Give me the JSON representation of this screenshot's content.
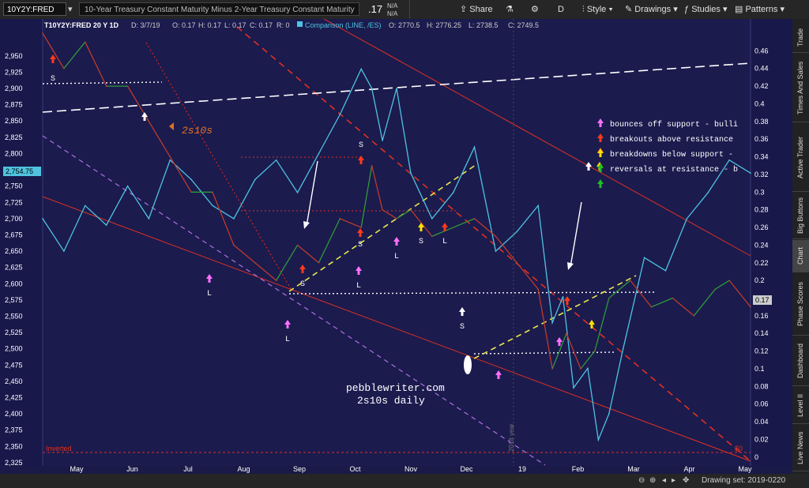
{
  "toolbar": {
    "symbol": "10Y2Y:FRED",
    "description": "10-Year Treasury Constant Maturity Minus 2-Year Treasury Constant Maturity",
    "last": ".17",
    "na1": "N/A",
    "na2": "N/A",
    "share": "Share",
    "flask": "⚗",
    "gear": "⚙",
    "period": "D",
    "style": "Style",
    "drawings": "Drawings",
    "studies": "Studies",
    "patterns": "Patterns"
  },
  "header": {
    "symbol_line": "T10Y2Y:FRED 20 Y 1D",
    "d": "D: 3/7/19",
    "o": "O: 0.17",
    "h": "H: 0.17",
    "l": "L: 0.17",
    "c": "C: 0.17",
    "r": "R: 0",
    "comparison": "Comparison (LINE, /ES)",
    "co": "O: 2770.5",
    "ch": "H: 2776.25",
    "cl": "L: 2738.5",
    "cc": "C: 2749.5"
  },
  "price_tag": "2,754.75",
  "last_tag": "0.17",
  "colors": {
    "background": "#1a1a48",
    "es_line": "#4fc3e0",
    "spread_up": "#2e9a3a",
    "spread_down": "#c0392b",
    "support_dashed": "#e8e84a",
    "channel_red": "#e03020",
    "channel_purple": "#b070e0",
    "white_dashed": "#ffffff",
    "arrow_pink": "#ff70ff",
    "arrow_red": "#ff3a1a",
    "arrow_yellow": "#ffe000",
    "arrow_green": "#20c020",
    "arrow_white": "#ffffff",
    "label_orange": "#e07020"
  },
  "legend": [
    {
      "text": "bounces off support - bulli",
      "color": "#ff70ff"
    },
    {
      "text": "breakouts above resistance",
      "color": "#ff3a1a"
    },
    {
      "text": "breakdowns below support -",
      "color": "#ffe000"
    },
    {
      "text": "reversals at resistance - b",
      "color": "#20c020"
    }
  ],
  "annotations": {
    "label_2s10s": "2s10s",
    "watermark_site": "pebblewriter.com",
    "watermark_desc": "2s10s daily",
    "inverted": "Inverted",
    "zero": "$0",
    "year_label": "2018 year"
  },
  "chart_data": {
    "type": "line",
    "title": "",
    "xlabel": "",
    "ylabel": "",
    "x_ticks": [
      "May",
      "Jun",
      "Jul",
      "Aug",
      "Sep",
      "Oct",
      "Nov",
      "Dec",
      "19",
      "Feb",
      "Mar",
      "Apr",
      "May"
    ],
    "left_axis": {
      "label": "/ES",
      "ylim": [
        2320,
        2985
      ],
      "ticks": [
        "2,950",
        "2,925",
        "2,900",
        "2,875",
        "2,850",
        "2,825",
        "2,800",
        "2,775",
        "2,750",
        "2,725",
        "2,700",
        "2,675",
        "2,650",
        "2,625",
        "2,600",
        "2,575",
        "2,550",
        "2,525",
        "2,500",
        "2,475",
        "2,450",
        "2,425",
        "2,400",
        "2,375",
        "2,350",
        "2,325"
      ]
    },
    "right_axis": {
      "label": "10Y2Y",
      "ylim": [
        -0.01,
        0.48
      ],
      "ticks": [
        "0.46",
        "0.44",
        "0.42",
        "0.4",
        "0.38",
        "0.36",
        "0.34",
        "0.32",
        "0.3",
        "0.28",
        "0.26",
        "0.24",
        "0.22",
        "0.2",
        "0.18",
        "0.16",
        "0.14",
        "0.12",
        "0.1",
        "0.08",
        "0.06",
        "0.04",
        "0.02",
        "0"
      ]
    },
    "series": [
      {
        "name": "/ES",
        "values_x": [
          0,
          0.3,
          0.6,
          0.9,
          1.2,
          1.5,
          1.8,
          2.1,
          2.4,
          2.7,
          3.0,
          3.3,
          3.6,
          3.9,
          4.2,
          4.5,
          4.65,
          4.8,
          5.0,
          5.2,
          5.5,
          5.8,
          6.1,
          6.4,
          6.7,
          7.0,
          7.2,
          7.35,
          7.5,
          7.7,
          7.85,
          8.0,
          8.2,
          8.5,
          8.8,
          9.1,
          9.4,
          9.7,
          10.0
        ],
        "values": [
          2700,
          2650,
          2720,
          2690,
          2750,
          2700,
          2790,
          2760,
          2720,
          2700,
          2760,
          2790,
          2740,
          2800,
          2860,
          2930,
          2900,
          2820,
          2900,
          2770,
          2700,
          2740,
          2810,
          2650,
          2680,
          2720,
          2540,
          2580,
          2440,
          2470,
          2360,
          2400,
          2500,
          2640,
          2620,
          2700,
          2740,
          2790,
          2770
        ]
      },
      {
        "name": "10Y2Y",
        "values_x": [
          0,
          0.3,
          0.6,
          0.9,
          1.2,
          1.5,
          1.8,
          2.1,
          2.4,
          2.7,
          3.0,
          3.3,
          3.6,
          3.9,
          4.2,
          4.5,
          4.65,
          4.8,
          5.0,
          5.2,
          5.5,
          5.8,
          6.1,
          6.4,
          6.7,
          7.0,
          7.2,
          7.4,
          7.6,
          7.8,
          8.0,
          8.3,
          8.6,
          8.9,
          9.2,
          9.5,
          9.7,
          10.0
        ],
        "values": [
          0.48,
          0.44,
          0.47,
          0.42,
          0.42,
          0.38,
          0.34,
          0.3,
          0.3,
          0.24,
          0.22,
          0.2,
          0.24,
          0.22,
          0.27,
          0.26,
          0.33,
          0.28,
          0.27,
          0.28,
          0.25,
          0.26,
          0.27,
          0.25,
          0.22,
          0.19,
          0.1,
          0.14,
          0.1,
          0.12,
          0.18,
          0.2,
          0.17,
          0.18,
          0.16,
          0.19,
          0.2,
          0.17
        ]
      }
    ]
  },
  "bottom": {
    "drawing_set": "Drawing set: 2019-0220"
  },
  "right_tabs": [
    "Trade",
    "Times And Sales",
    "Active Trader",
    "Big Buttons",
    "Chart",
    "Phase Scores",
    "Dashboard",
    "Level II",
    "Live News"
  ]
}
